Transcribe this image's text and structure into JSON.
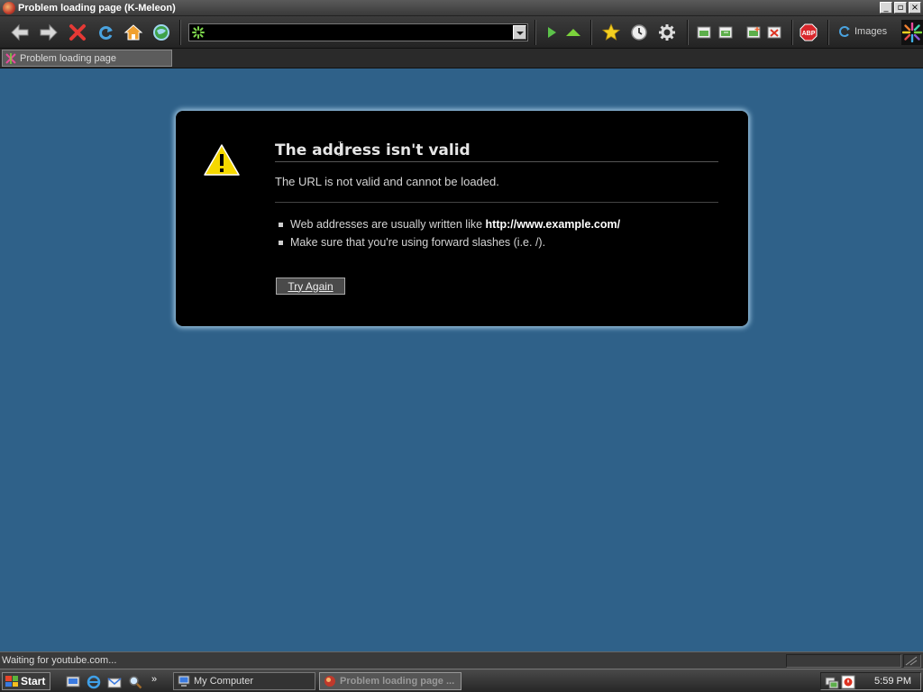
{
  "window": {
    "title": "Problem loading page (K-Meleon)"
  },
  "toolbar": {
    "icons": [
      "back-icon",
      "forward-icon",
      "stop-icon",
      "reload-icon",
      "home-icon",
      "globe-icon",
      "go-icon",
      "up-icon",
      "bookmarks-icon",
      "history-icon",
      "settings-icon",
      "layer-icon",
      "layer-next-icon",
      "new-layer-icon",
      "close-layer-icon",
      "adblock-icon",
      "kmeleon-logo"
    ],
    "url_value": "",
    "images_label": "Images",
    "adblock_label": "ABP"
  },
  "tab": {
    "label": "Problem loading page"
  },
  "error": {
    "title": "The address isn't valid",
    "message": "The URL is not valid and cannot be loaded.",
    "tips": [
      {
        "text": "Web addresses are usually written like ",
        "bold": "http://www.example.com/"
      },
      {
        "text": "Make sure that you're using forward slashes (i.e. /).",
        "bold": ""
      }
    ],
    "button": "Try Again"
  },
  "status": {
    "text": "Waiting for youtube.com..."
  },
  "taskbar": {
    "start_label": "Start",
    "tasks": [
      {
        "label": "My Computer",
        "active": false
      },
      {
        "label": "Problem loading page ...",
        "active": true
      }
    ],
    "overflow": "»",
    "clock": "5:59 PM"
  },
  "colors": {
    "background": "#2f6189",
    "box": "#000000",
    "glow": "#9ec6e0"
  }
}
